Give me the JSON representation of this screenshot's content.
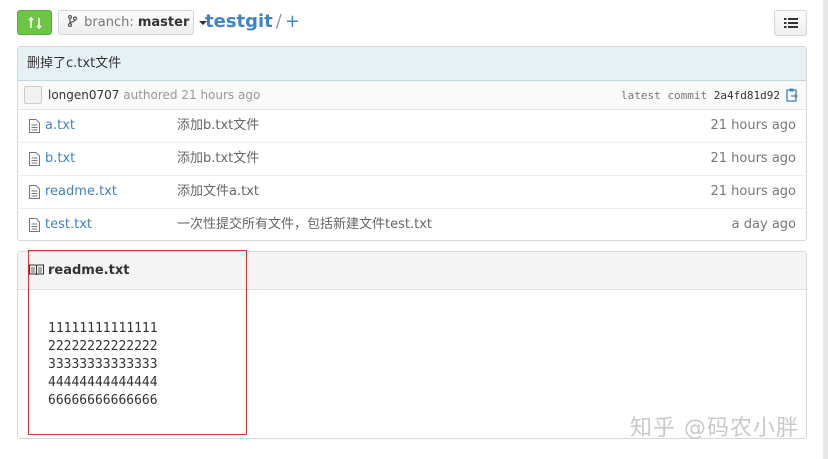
{
  "header": {
    "branch_label": "branch:",
    "branch_name": "master",
    "repo_name": "testgit",
    "separator": "/",
    "plus": "+"
  },
  "commit": {
    "message": "删掉了c.txt文件",
    "author": "longen0707",
    "authored_text": "authored 21 hours ago",
    "latest_label": "latest commit",
    "sha": "2a4fd81d92"
  },
  "files": [
    {
      "name": "a.txt",
      "message": "添加b.txt文件",
      "age": "21 hours ago"
    },
    {
      "name": "b.txt",
      "message": "添加b.txt文件",
      "age": "21 hours ago"
    },
    {
      "name": "readme.txt",
      "message": "添加文件a.txt",
      "age": "21 hours ago"
    },
    {
      "name": "test.txt",
      "message": "一次性提交所有文件，包括新建文件test.txt",
      "age": "a day ago"
    }
  ],
  "readme": {
    "title": "readme.txt",
    "lines": [
      "11111111111111",
      "22222222222222",
      "33333333333333",
      "44444444444444",
      "66666666666666"
    ]
  },
  "watermark": "知乎 @码农小胖",
  "colors": {
    "accent": "#4183c4",
    "compare_green": "#6cc644",
    "commit_bg": "#e6f1f6",
    "highlight_red": "#e0302e"
  }
}
